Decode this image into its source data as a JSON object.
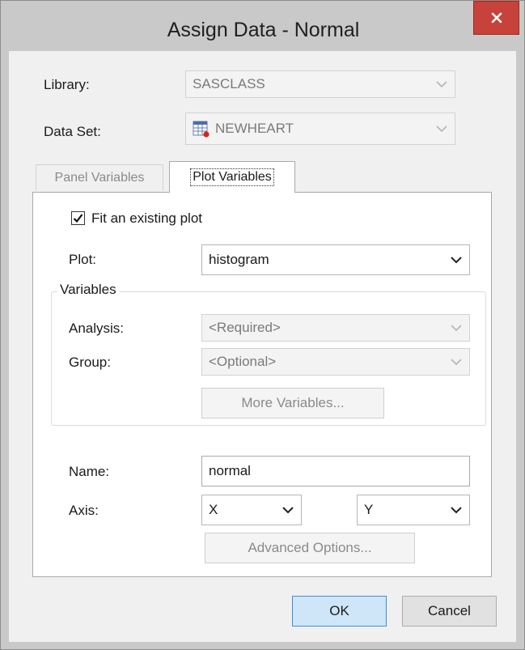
{
  "window": {
    "title": "Assign Data - Normal",
    "close_glyph": "x"
  },
  "library": {
    "label": "Library:",
    "value": "SASCLASS"
  },
  "dataset": {
    "label": "Data Set:",
    "value": "NEWHEART",
    "icon": "dataset-table-icon"
  },
  "tabs": [
    {
      "label": "Panel Variables",
      "active": false
    },
    {
      "label": "Plot Variables",
      "active": true
    }
  ],
  "plot_tab": {
    "fit_existing": {
      "label": "Fit an existing plot",
      "checked": true
    },
    "plot": {
      "label": "Plot:",
      "value": "histogram"
    },
    "variables_group": {
      "title": "Variables",
      "analysis": {
        "label": "Analysis:",
        "value": "<Required>"
      },
      "group": {
        "label": "Group:",
        "value": "<Optional>"
      },
      "more_button": "More Variables..."
    },
    "name": {
      "label": "Name:",
      "value": "normal"
    },
    "axis": {
      "label": "Axis:",
      "x_value": "X",
      "y_value": "Y"
    },
    "advanced_button": "Advanced Options..."
  },
  "footer": {
    "ok": "OK",
    "cancel": "Cancel"
  },
  "colors": {
    "close_button": "#c7423a",
    "ok_button_border": "#3c8fd6",
    "ok_button_fill": "#cfe6f8"
  }
}
